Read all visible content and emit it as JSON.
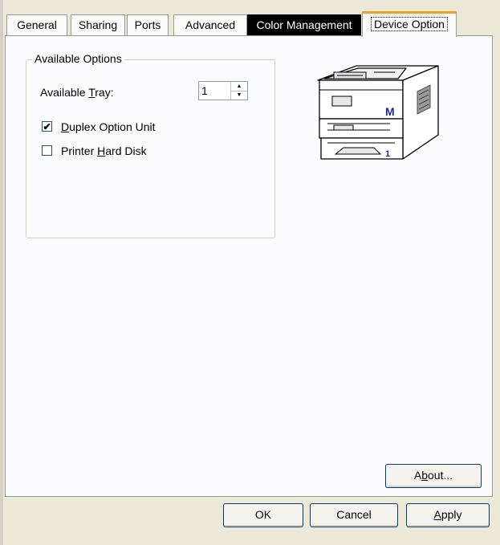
{
  "tabs": [
    {
      "label": "General"
    },
    {
      "label": "Sharing"
    },
    {
      "label": "Ports"
    },
    {
      "label": "Advanced"
    },
    {
      "label": "Color Management"
    },
    {
      "label": "Device Option"
    }
  ],
  "available_options": {
    "group_title": "Available Options",
    "tray_label_pre": "Available ",
    "tray_label_mnemonic": "T",
    "tray_label_post": "ray:",
    "tray_value": "1",
    "duplex": {
      "mnemonic": "D",
      "label_rest": "uplex Option Unit",
      "checked": true,
      "check_mark": "✔"
    },
    "hard_disk": {
      "label_pre": "Printer ",
      "mnemonic": "H",
      "label_rest": "ard Disk",
      "checked": false
    }
  },
  "printer_illustration": {
    "front_letter": "M",
    "tray_number": "1"
  },
  "buttons": {
    "about_pre": "A",
    "about_mnemonic": "b",
    "about_post": "out...",
    "ok": "OK",
    "cancel": "Cancel",
    "apply_mnemonic": "A",
    "apply_rest": "pply"
  },
  "colors": {
    "dialog_bg": "#ECE9D8",
    "panel_bg": "#FCFCFE",
    "active_tab_accent": "#F0A020",
    "printer_label_blue": "#1A2AA0"
  },
  "spinner_icons": {
    "up": "▲",
    "down": "▼"
  }
}
